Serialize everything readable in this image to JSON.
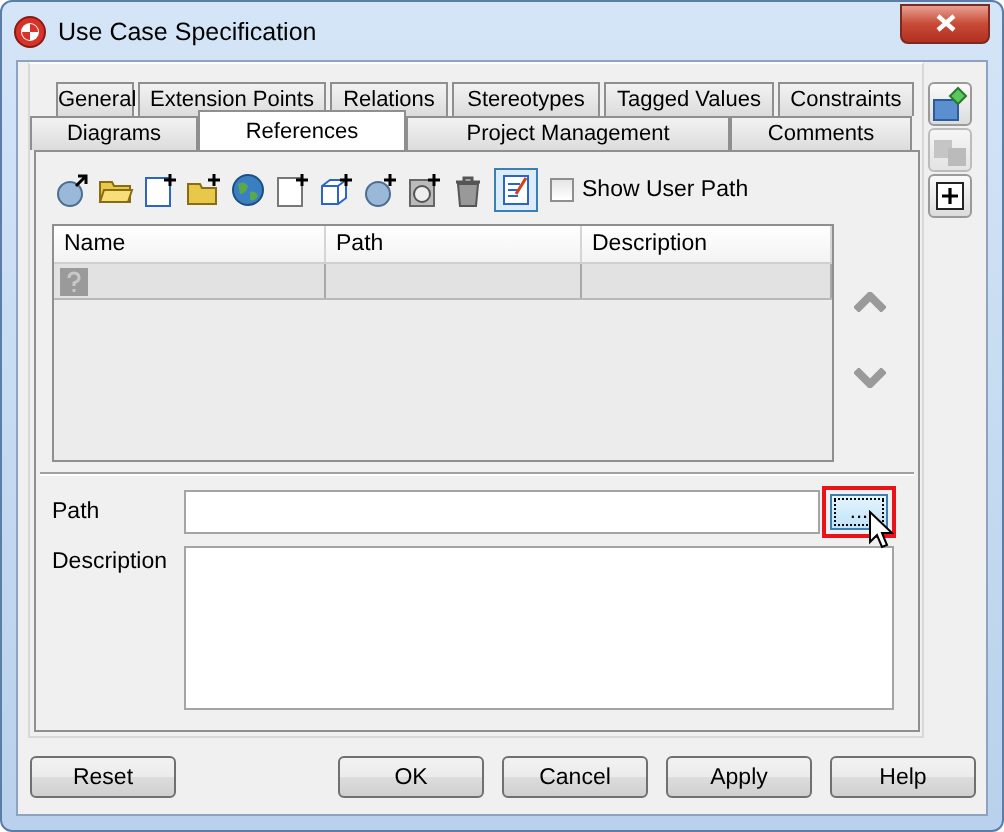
{
  "window": {
    "title": "Use Case Specification"
  },
  "tab_rows": [
    [
      {
        "label": "General",
        "selected": false
      },
      {
        "label": "Extension Points",
        "selected": false
      },
      {
        "label": "Relations",
        "selected": false
      },
      {
        "label": "Stereotypes",
        "selected": false
      },
      {
        "label": "Tagged Values",
        "selected": false
      },
      {
        "label": "Constraints",
        "selected": false
      }
    ],
    [
      {
        "label": "Diagrams",
        "selected": false
      },
      {
        "label": "References",
        "selected": true
      },
      {
        "label": "Project Management",
        "selected": false
      },
      {
        "label": "Comments",
        "selected": false
      }
    ]
  ],
  "side_buttons": [
    {
      "disabled": false
    },
    {
      "disabled": true
    },
    {
      "disabled": false
    }
  ],
  "toolbar": {
    "edit_toggle_on": true,
    "show_user_path": {
      "label": "Show User Path",
      "checked": false
    }
  },
  "table": {
    "columns": [
      "Name",
      "Path",
      "Description"
    ],
    "rows": [
      {
        "selected": true
      }
    ]
  },
  "form": {
    "path_label": "Path",
    "browse_button": {
      "label": "...",
      "highlighted": true
    },
    "description_label": "Description"
  },
  "footer_buttons": [
    {
      "label": "Reset",
      "kind": "left"
    },
    {
      "label": "OK",
      "kind": "right"
    },
    {
      "label": "Cancel",
      "kind": "right"
    },
    {
      "label": "Apply",
      "kind": "right"
    },
    {
      "label": "Help",
      "kind": "right"
    }
  ]
}
